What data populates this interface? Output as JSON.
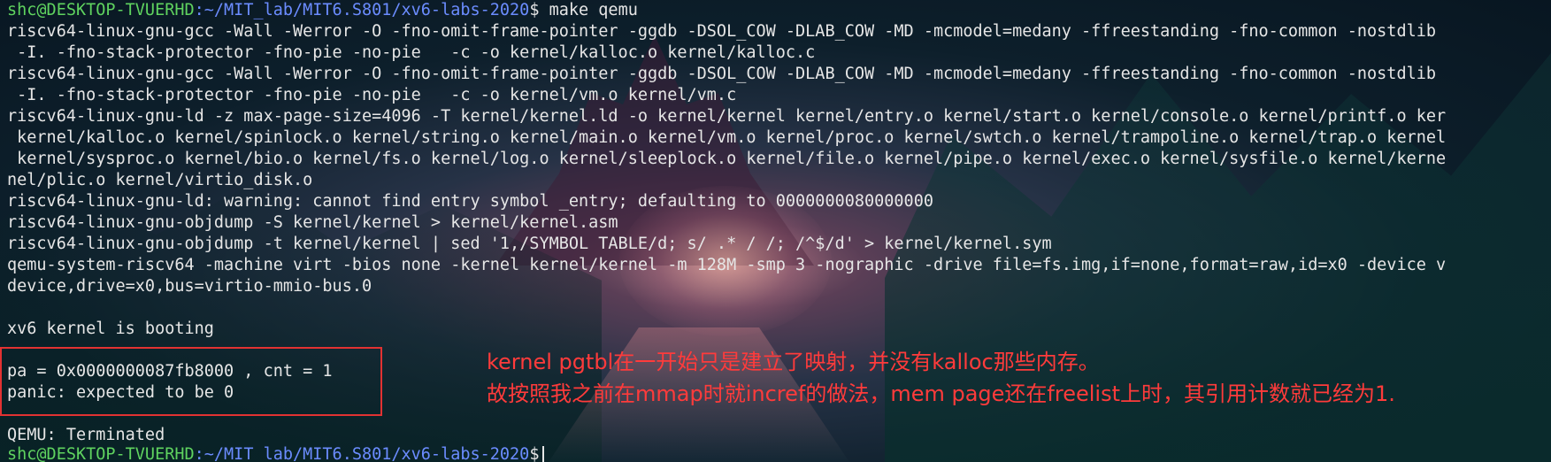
{
  "prompt": {
    "user_host": "shc@DESKTOP-TVUERHD",
    "path": ":~/MIT_lab/MIT6.S801/xv6-labs-2020",
    "symbol": "$",
    "command": " make qemu"
  },
  "output_lines": [
    "riscv64-linux-gnu-gcc -Wall -Werror -O -fno-omit-frame-pointer -ggdb -DSOL_COW -DLAB_COW -MD -mcmodel=medany -ffreestanding -fno-common -nostdlib",
    " -I. -fno-stack-protector -fno-pie -no-pie   -c -o kernel/kalloc.o kernel/kalloc.c",
    "riscv64-linux-gnu-gcc -Wall -Werror -O -fno-omit-frame-pointer -ggdb -DSOL_COW -DLAB_COW -MD -mcmodel=medany -ffreestanding -fno-common -nostdlib",
    " -I. -fno-stack-protector -fno-pie -no-pie   -c -o kernel/vm.o kernel/vm.c",
    "riscv64-linux-gnu-ld -z max-page-size=4096 -T kernel/kernel.ld -o kernel/kernel kernel/entry.o kernel/start.o kernel/console.o kernel/printf.o ker",
    " kernel/kalloc.o kernel/spinlock.o kernel/string.o kernel/main.o kernel/vm.o kernel/proc.o kernel/swtch.o kernel/trampoline.o kernel/trap.o kernel",
    " kernel/sysproc.o kernel/bio.o kernel/fs.o kernel/log.o kernel/sleeplock.o kernel/file.o kernel/pipe.o kernel/exec.o kernel/sysfile.o kernel/kerne",
    "nel/plic.o kernel/virtio_disk.o",
    "riscv64-linux-gnu-ld: warning: cannot find entry symbol _entry; defaulting to 0000000080000000",
    "riscv64-linux-gnu-objdump -S kernel/kernel > kernel/kernel.asm",
    "riscv64-linux-gnu-objdump -t kernel/kernel | sed '1,/SYMBOL TABLE/d; s/ .* / /; /^$/d' > kernel/kernel.sym",
    "qemu-system-riscv64 -machine virt -bios none -kernel kernel/kernel -m 128M -smp 3 -nographic -drive file=fs.img,if=none,format=raw,id=x0 -device v",
    "device,drive=x0,bus=virtio-mmio-bus.0",
    "",
    "xv6 kernel is booting",
    "",
    "pa = 0x0000000087fb8000 , cnt = 1",
    "panic: expected to be 0",
    "",
    "QEMU: Terminated"
  ],
  "annotation": {
    "line1": "kernel pgtbl在一开始只是建立了映射，并没有kalloc那些内存。",
    "line2": "故按照我之前在mmap时就incref的做法，mem page还在freelist上时，其引用计数就已经为1."
  },
  "colors": {
    "prompt_user": "#5fd35f",
    "prompt_path": "#6b8cff",
    "annotation": "#ff3b3b",
    "box": "#e23232"
  }
}
